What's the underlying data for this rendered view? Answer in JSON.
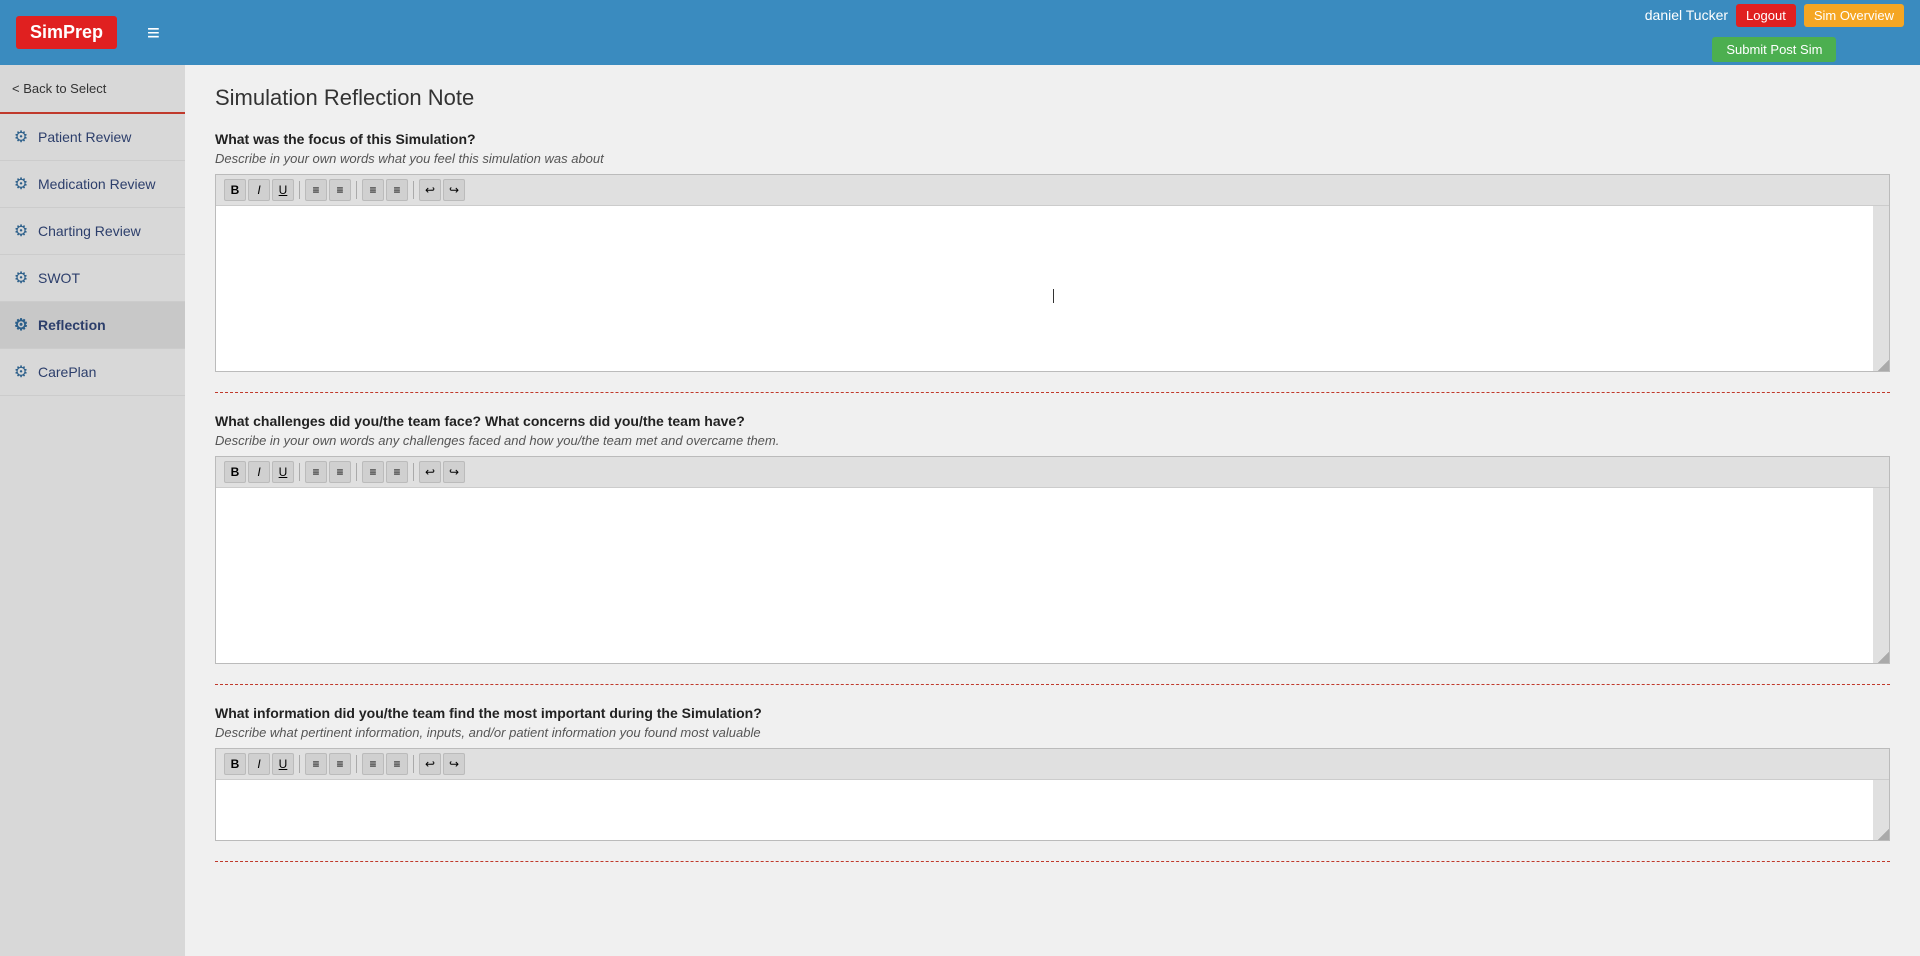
{
  "header": {
    "logo": "SimPrep",
    "hamburger": "≡",
    "user": "daniel Tucker",
    "logout_label": "Logout",
    "sim_overview_label": "Sim Overview",
    "submit_label": "Submit Post Sim"
  },
  "sidebar": {
    "back_label": "< Back to Select",
    "items": [
      {
        "id": "patient-review",
        "label": "Patient Review",
        "icon": "⚙"
      },
      {
        "id": "medication-review",
        "label": "Medication Review",
        "icon": "⚙"
      },
      {
        "id": "charting-review",
        "label": "Charting Review",
        "icon": "⚙"
      },
      {
        "id": "swot",
        "label": "SWOT",
        "icon": "⚙"
      },
      {
        "id": "reflection",
        "label": "Reflection",
        "icon": "⚙",
        "active": true
      },
      {
        "id": "careplan",
        "label": "CarePlan",
        "icon": "⚙"
      }
    ]
  },
  "page": {
    "title": "Simulation Reflection Note",
    "sections": [
      {
        "id": "focus",
        "question": "What was the focus of this Simulation?",
        "subtitle": "Describe in your own words what you feel this simulation was about"
      },
      {
        "id": "challenges",
        "question": "What challenges did you/the team face? What concerns did you/the team have?",
        "subtitle": "Describe in your own words any challenges faced and how you/the team met and overcame them."
      },
      {
        "id": "important",
        "question": "What information did you/the team find the most important during the Simulation?",
        "subtitle": "Describe what pertinent information, inputs, and/or patient information you found most valuable"
      }
    ]
  },
  "toolbar": {
    "buttons": [
      "B",
      "I",
      "U",
      "≡",
      "≡",
      "≡",
      "≡",
      "↩",
      "↪"
    ]
  }
}
